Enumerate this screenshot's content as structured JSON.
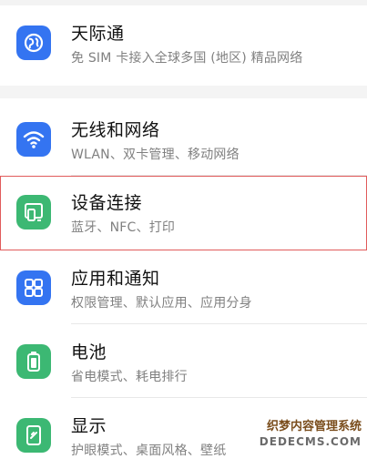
{
  "settings": {
    "items": [
      {
        "title": "天际通",
        "subtitle": "免 SIM 卡接入全球多国 (地区) 精品网络",
        "icon": "globe-icon",
        "icon_color": "#3474f1"
      },
      {
        "title": "无线和网络",
        "subtitle": "WLAN、双卡管理、移动网络",
        "icon": "wifi-icon",
        "icon_color": "#3474f1"
      },
      {
        "title": "设备连接",
        "subtitle": "蓝牙、NFC、打印",
        "icon": "device-connection-icon",
        "icon_color": "#3cb873",
        "highlighted": true
      },
      {
        "title": "应用和通知",
        "subtitle": "权限管理、默认应用、应用分身",
        "icon": "apps-icon",
        "icon_color": "#3474f1"
      },
      {
        "title": "电池",
        "subtitle": "省电模式、耗电排行",
        "icon": "battery-icon",
        "icon_color": "#3cb873"
      },
      {
        "title": "显示",
        "subtitle": "护眼模式、桌面风格、壁纸",
        "icon": "display-icon",
        "icon_color": "#3cb873"
      }
    ]
  },
  "watermark": {
    "line1": "织梦内容管理系统",
    "line2": "DEDECMS.COM"
  },
  "colors": {
    "highlight_border": "#e15b5b",
    "title": "#111111",
    "subtitle": "#808080",
    "section_gap": "#f4f4f4"
  }
}
